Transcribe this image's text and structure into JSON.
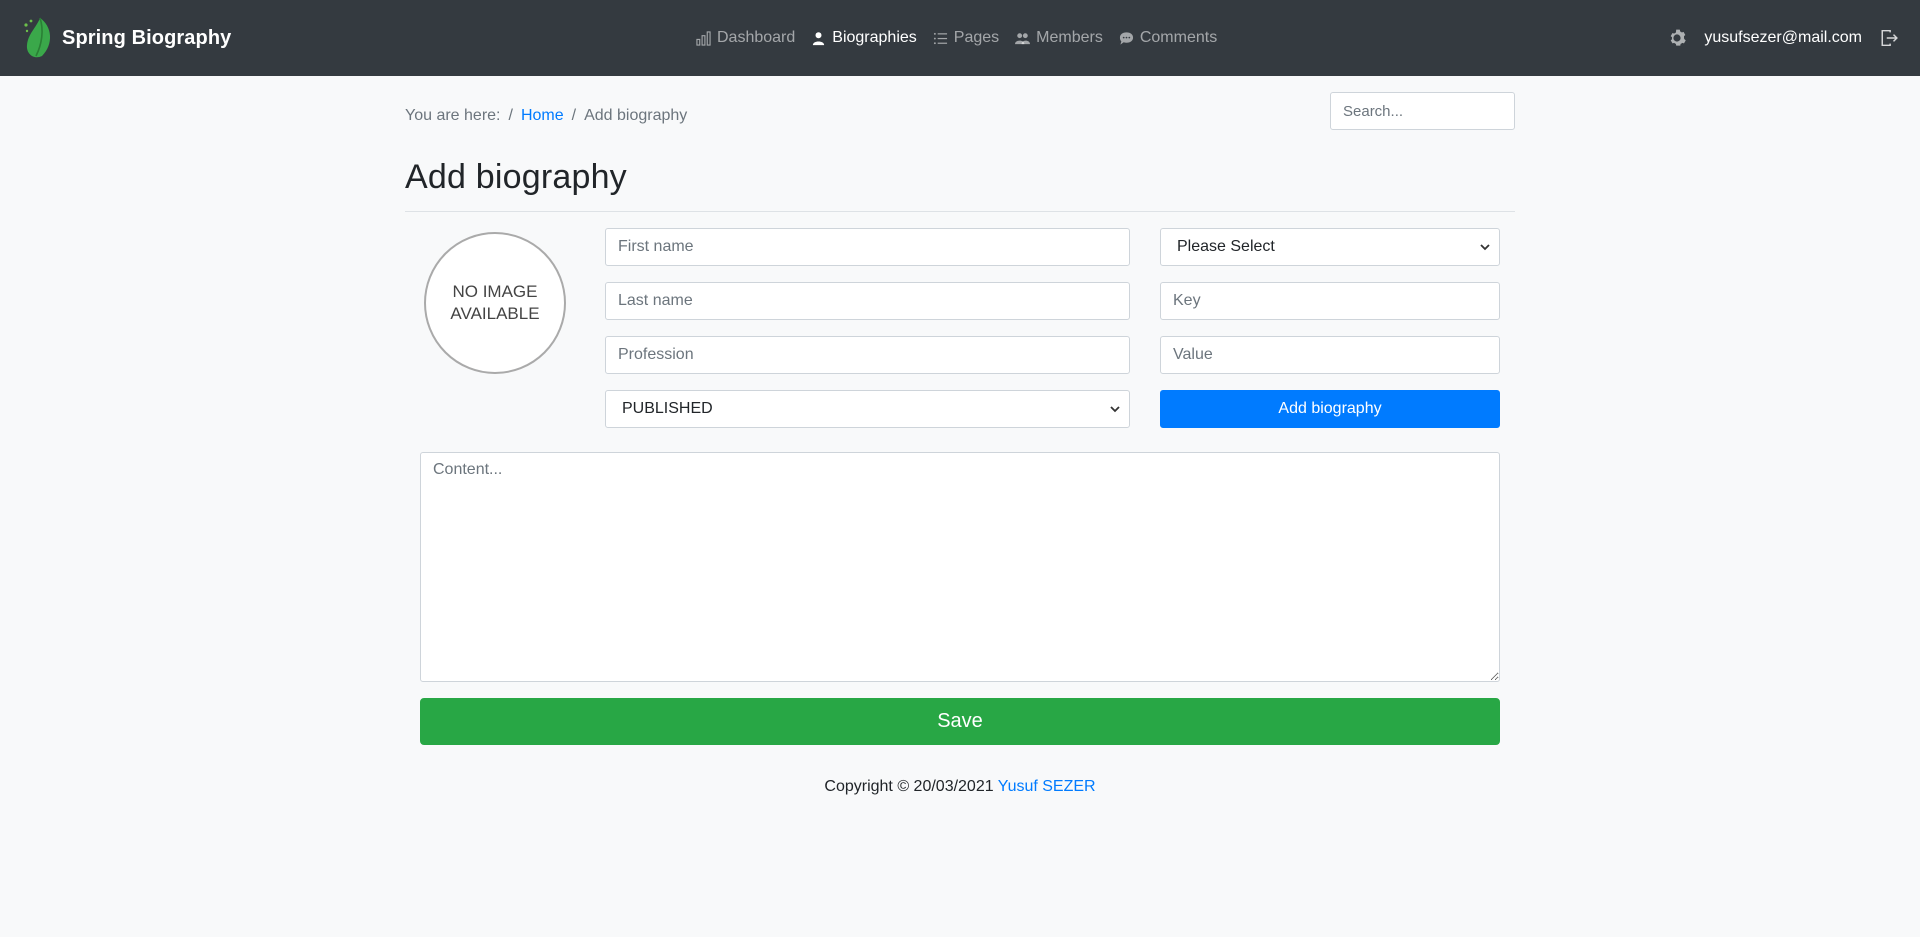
{
  "navbar": {
    "brand": "Spring Biography",
    "links": [
      {
        "label": "Dashboard",
        "icon": "chart-icon",
        "active": false
      },
      {
        "label": "Biographies",
        "icon": "person-icon",
        "active": true
      },
      {
        "label": "Pages",
        "icon": "list-icon",
        "active": false
      },
      {
        "label": "Members",
        "icon": "people-icon",
        "active": false
      },
      {
        "label": "Comments",
        "icon": "chat-icon",
        "active": false
      }
    ],
    "user_email": "yusufsezer@mail.com"
  },
  "breadcrumb": {
    "prefix": "You are here:",
    "sep": "/",
    "home": "Home",
    "current": "Add biography"
  },
  "search": {
    "placeholder": "Search..."
  },
  "page": {
    "title": "Add biography"
  },
  "form": {
    "avatar_line1": "NO IMAGE",
    "avatar_line2": "AVAILABLE",
    "first_name_placeholder": "First name",
    "last_name_placeholder": "Last name",
    "profession_placeholder": "Profession",
    "status_value": "PUBLISHED",
    "category_value": "Please Select",
    "key_placeholder": "Key",
    "value_placeholder": "Value",
    "add_label": "Add biography",
    "content_placeholder": "Content...",
    "save_label": "Save"
  },
  "footer": {
    "text": "Copyright © 20/03/2021",
    "author": "Yusuf SEZER"
  },
  "colors": {
    "navbar": "#343a40",
    "primary": "#007bff",
    "success": "#28a745",
    "brand_green": "#3aa84a"
  }
}
